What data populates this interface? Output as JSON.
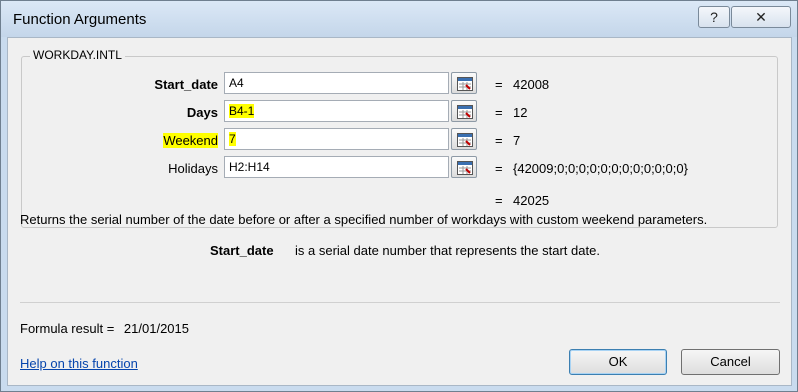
{
  "window": {
    "title": "Function Arguments",
    "help_label": "?",
    "close_label": "✕"
  },
  "function": {
    "name": "WORKDAY.INTL"
  },
  "arguments": [
    {
      "label": "Start_date",
      "value": "A4",
      "result": "42008"
    },
    {
      "label": "Days",
      "value": "B4-1",
      "result": "12"
    },
    {
      "label": "Weekend",
      "value": "7",
      "result": "7"
    },
    {
      "label": "Holidays",
      "value": "H2:H14",
      "result": "{42009;0;0;0;0;0;0;0;0;0;0;0;0}"
    }
  ],
  "equals_sign": "=",
  "total": {
    "result": "42025"
  },
  "description": "Returns the serial number of the date before or after a specified number of workdays with custom weekend parameters.",
  "arg_description": {
    "name": "Start_date",
    "text": "is a serial date number that represents the start date."
  },
  "formula_result": {
    "label": "Formula result =",
    "value": "21/01/2015"
  },
  "help_link": "Help on this function",
  "buttons": {
    "ok": "OK",
    "cancel": "Cancel"
  },
  "icons": {
    "ref_button": "collapse-dialog-icon"
  },
  "colors": {
    "highlight": "#ffff00",
    "link": "#0645ad"
  }
}
